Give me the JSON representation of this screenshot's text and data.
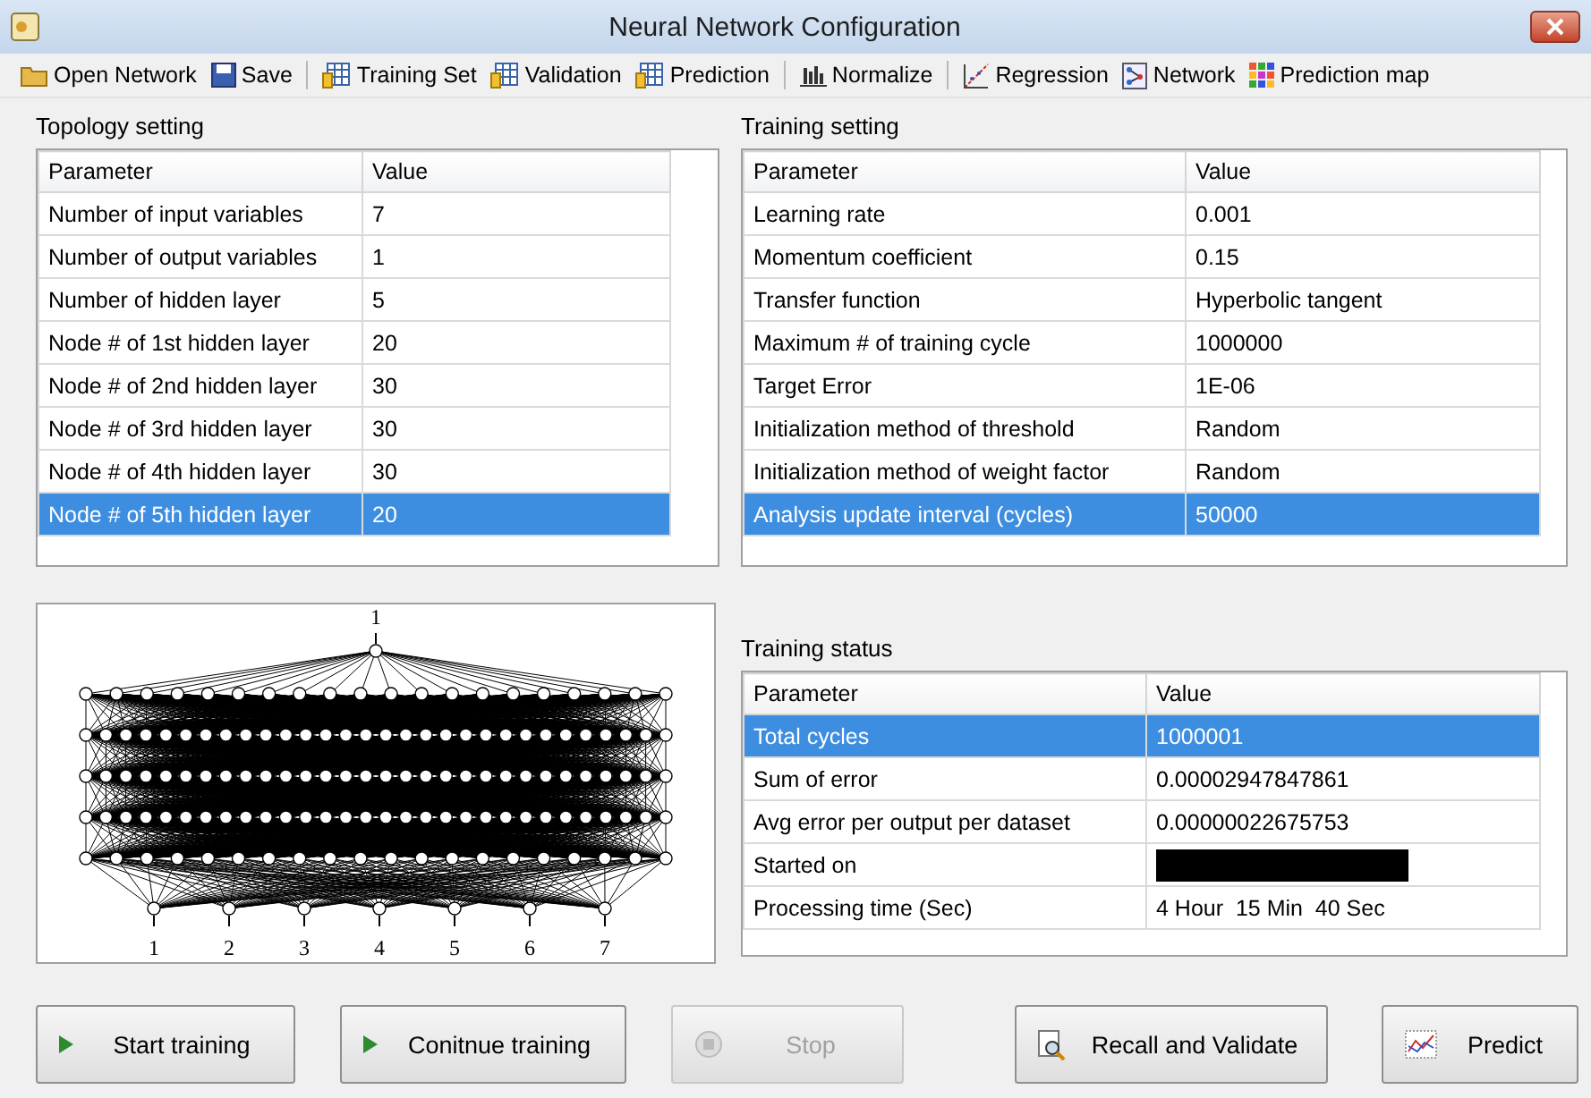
{
  "window": {
    "title": "Neural Network Configuration"
  },
  "toolbar": [
    {
      "label": "Open Network",
      "kind": "folder"
    },
    {
      "label": "Save",
      "kind": "save",
      "separator_after": true
    },
    {
      "label": "Training Set",
      "kind": "sheet"
    },
    {
      "label": "Validation",
      "kind": "sheet"
    },
    {
      "label": "Prediction",
      "kind": "sheet",
      "separator_after": true
    },
    {
      "label": "Normalize",
      "kind": "bars",
      "separator_after": true
    },
    {
      "label": "Regression",
      "kind": "scatter"
    },
    {
      "label": "Network",
      "kind": "network"
    },
    {
      "label": "Prediction map",
      "kind": "grid"
    }
  ],
  "topology": {
    "title": "Topology setting",
    "columns": [
      "Parameter",
      "Value"
    ],
    "rows": [
      {
        "cells": [
          "Number of input variables",
          "7"
        ],
        "selected": false
      },
      {
        "cells": [
          "Number of output variables",
          "1"
        ],
        "selected": false
      },
      {
        "cells": [
          "Number of hidden layer",
          "5"
        ],
        "selected": false
      },
      {
        "cells": [
          "Node # of 1st hidden layer",
          "20"
        ],
        "selected": false
      },
      {
        "cells": [
          "Node # of 2nd hidden layer",
          "30"
        ],
        "selected": false
      },
      {
        "cells": [
          "Node # of 3rd hidden layer",
          "30"
        ],
        "selected": false
      },
      {
        "cells": [
          "Node # of 4th hidden layer",
          "30"
        ],
        "selected": false
      },
      {
        "cells": [
          "Node # of 5th hidden layer",
          "20"
        ],
        "selected": true
      }
    ]
  },
  "training_setting": {
    "title": "Training setting",
    "columns": [
      "Parameter",
      "Value"
    ],
    "rows": [
      {
        "cells": [
          "Learning rate",
          "0.001"
        ],
        "selected": false
      },
      {
        "cells": [
          "Momentum coefficient",
          "0.15"
        ],
        "selected": false
      },
      {
        "cells": [
          "Transfer function",
          "Hyperbolic tangent"
        ],
        "selected": false
      },
      {
        "cells": [
          "Maximum # of training cycle",
          "1000000"
        ],
        "selected": false
      },
      {
        "cells": [
          "Target Error",
          "1E-06"
        ],
        "selected": false
      },
      {
        "cells": [
          "Initialization method of threshold",
          "Random"
        ],
        "selected": false
      },
      {
        "cells": [
          "Initialization method of weight factor",
          "Random"
        ],
        "selected": false
      },
      {
        "cells": [
          "Analysis update interval (cycles)",
          "50000"
        ],
        "selected": true
      }
    ]
  },
  "network_diagram": {
    "output_labels": [
      "1"
    ],
    "input_labels": [
      "1",
      "2",
      "3",
      "4",
      "5",
      "6",
      "7"
    ]
  },
  "training_status": {
    "title": "Training status",
    "columns": [
      "Parameter",
      "Value"
    ],
    "rows": [
      {
        "cells": [
          "Total cycles",
          "1000001"
        ],
        "selected": true,
        "kind": "text"
      },
      {
        "cells": [
          "Sum of error",
          "0.00002947847861"
        ],
        "selected": false,
        "kind": "text"
      },
      {
        "cells": [
          "Avg error per output per dataset",
          "0.00000022675753"
        ],
        "selected": false,
        "kind": "text"
      },
      {
        "cells": [
          "Started on"
        ],
        "selected": false,
        "kind": "redacted"
      },
      {
        "cells": [
          "Processing time (Sec)",
          "4 Hour  15 Min  40 Sec"
        ],
        "selected": false,
        "kind": "text"
      }
    ]
  },
  "buttons": [
    {
      "label": "Start training",
      "kind": "play",
      "disabled": false
    },
    {
      "label": "Conitnue training",
      "kind": "play",
      "disabled": false
    },
    {
      "label": "Stop",
      "kind": "stop",
      "disabled": true
    },
    {
      "label": "Recall and Validate",
      "kind": "magnifier",
      "disabled": false
    },
    {
      "label": "Predict",
      "kind": "chart",
      "disabled": false
    }
  ]
}
